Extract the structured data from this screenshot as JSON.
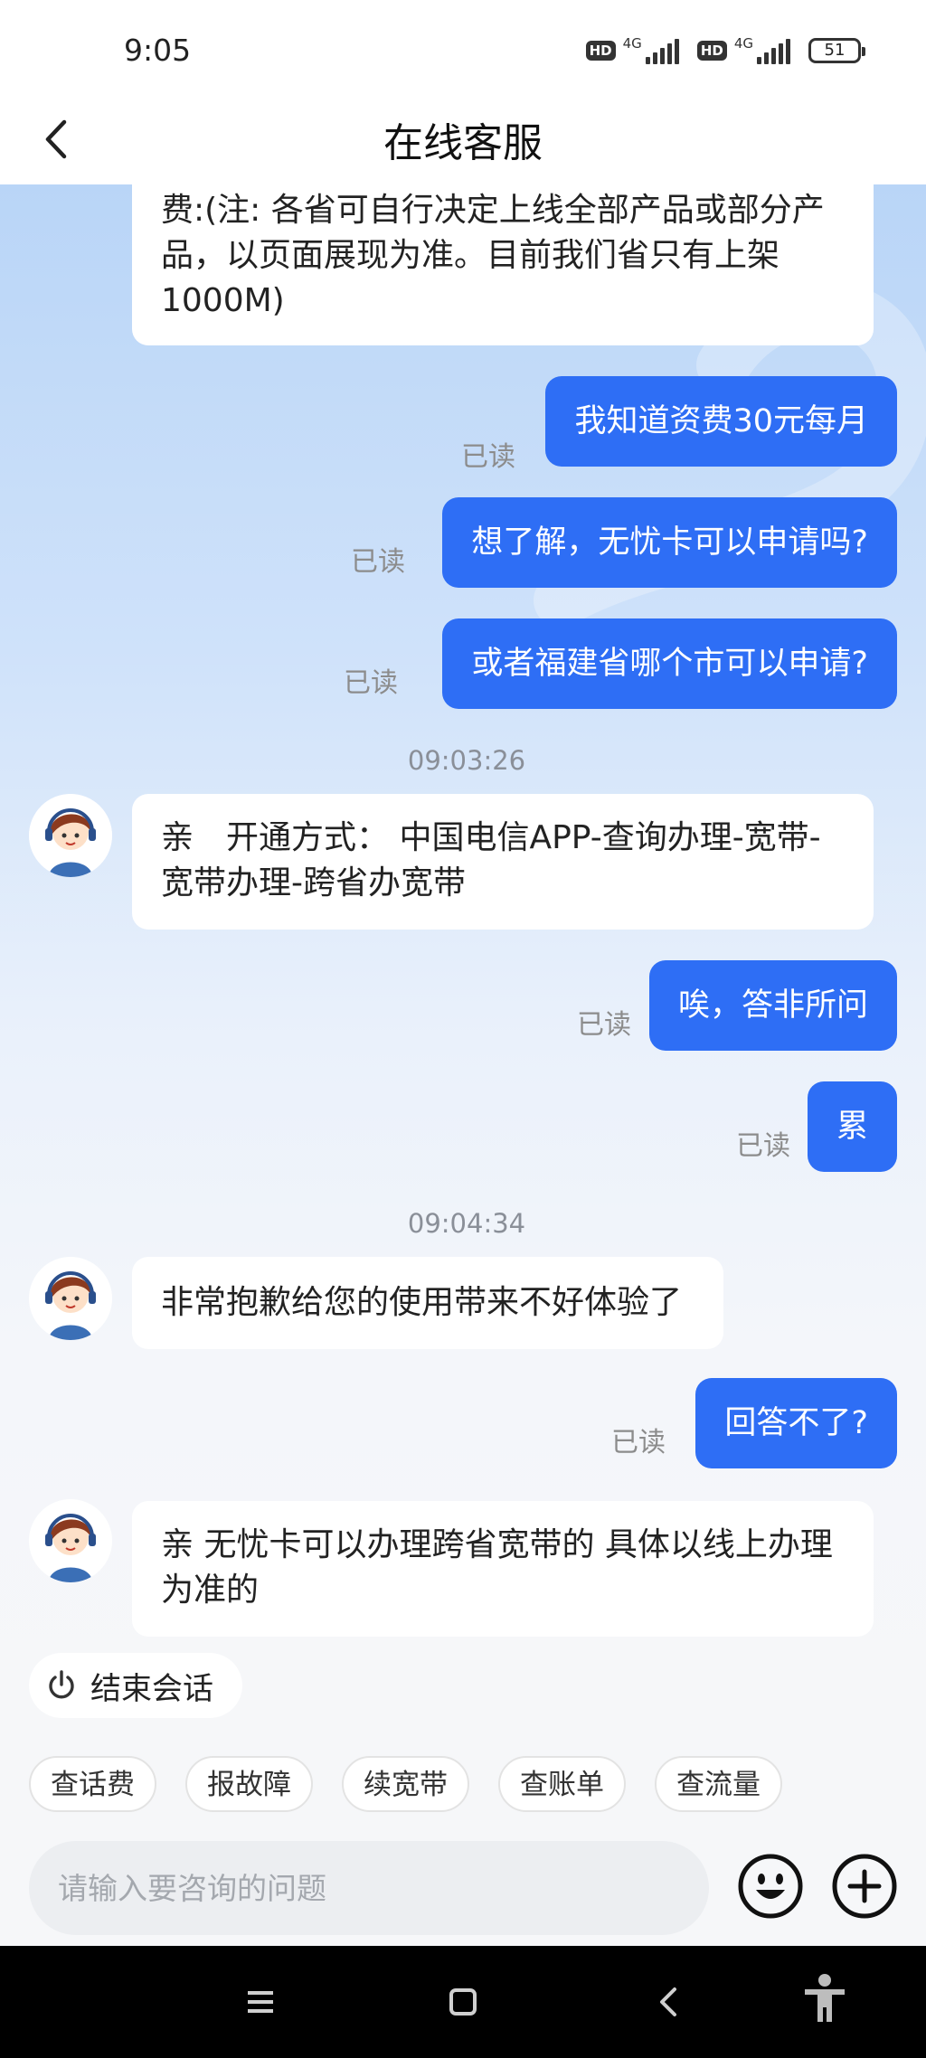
{
  "status_bar": {
    "time": "9:05",
    "hd_label": "HD",
    "network_label": "4G",
    "battery": "51"
  },
  "header": {
    "title": "在线客服"
  },
  "messages": [
    {
      "type": "in",
      "text": "费:(注: 各省可自行决定上线全部产品或部分产品，以页面展现为准。目前我们省只有上架1000M)"
    },
    {
      "type": "out",
      "text": "我知道资费30元每月",
      "read": "已读"
    },
    {
      "type": "out",
      "text": "想了解，无忧卡可以申请吗?",
      "read": "已读"
    },
    {
      "type": "out",
      "text": "或者福建省哪个市可以申请?",
      "read": "已读"
    },
    {
      "type": "time",
      "text": "09:03:26"
    },
    {
      "type": "in",
      "text": "亲　开通方式：  中国电信APP-查询办理-宽带-宽带办理-跨省办宽带"
    },
    {
      "type": "out",
      "text": "唉，答非所问",
      "read": "已读"
    },
    {
      "type": "out",
      "text": "累",
      "read": "已读"
    },
    {
      "type": "time",
      "text": "09:04:34"
    },
    {
      "type": "in",
      "text": "非常抱歉给您的使用带来不好体验了"
    },
    {
      "type": "out",
      "text": "回答不了?",
      "read": "已读"
    },
    {
      "type": "in",
      "text": "亲  无忧卡可以办理跨省宽带的  具体以线上办理为准的"
    }
  ],
  "end_session_label": "结束会话",
  "quick_replies": [
    "查话费",
    "报故障",
    "续宽带",
    "查账单",
    "查流量"
  ],
  "input": {
    "placeholder": "请输入要咨询的问题",
    "value": ""
  },
  "icons": {
    "back": "chevron-left-icon",
    "end_session": "power-icon",
    "emoji": "smiley-icon",
    "plus": "plus-circle-icon",
    "nav_menu": "menu-icon",
    "nav_home": "home-square-icon",
    "nav_back": "back-triangle-icon",
    "nav_accessibility": "accessibility-icon"
  },
  "colors": {
    "accent_bubble": "#2e6ef5",
    "chat_bg_top": "#b9d5f7",
    "chat_bg_bottom": "#f6f7f9"
  }
}
